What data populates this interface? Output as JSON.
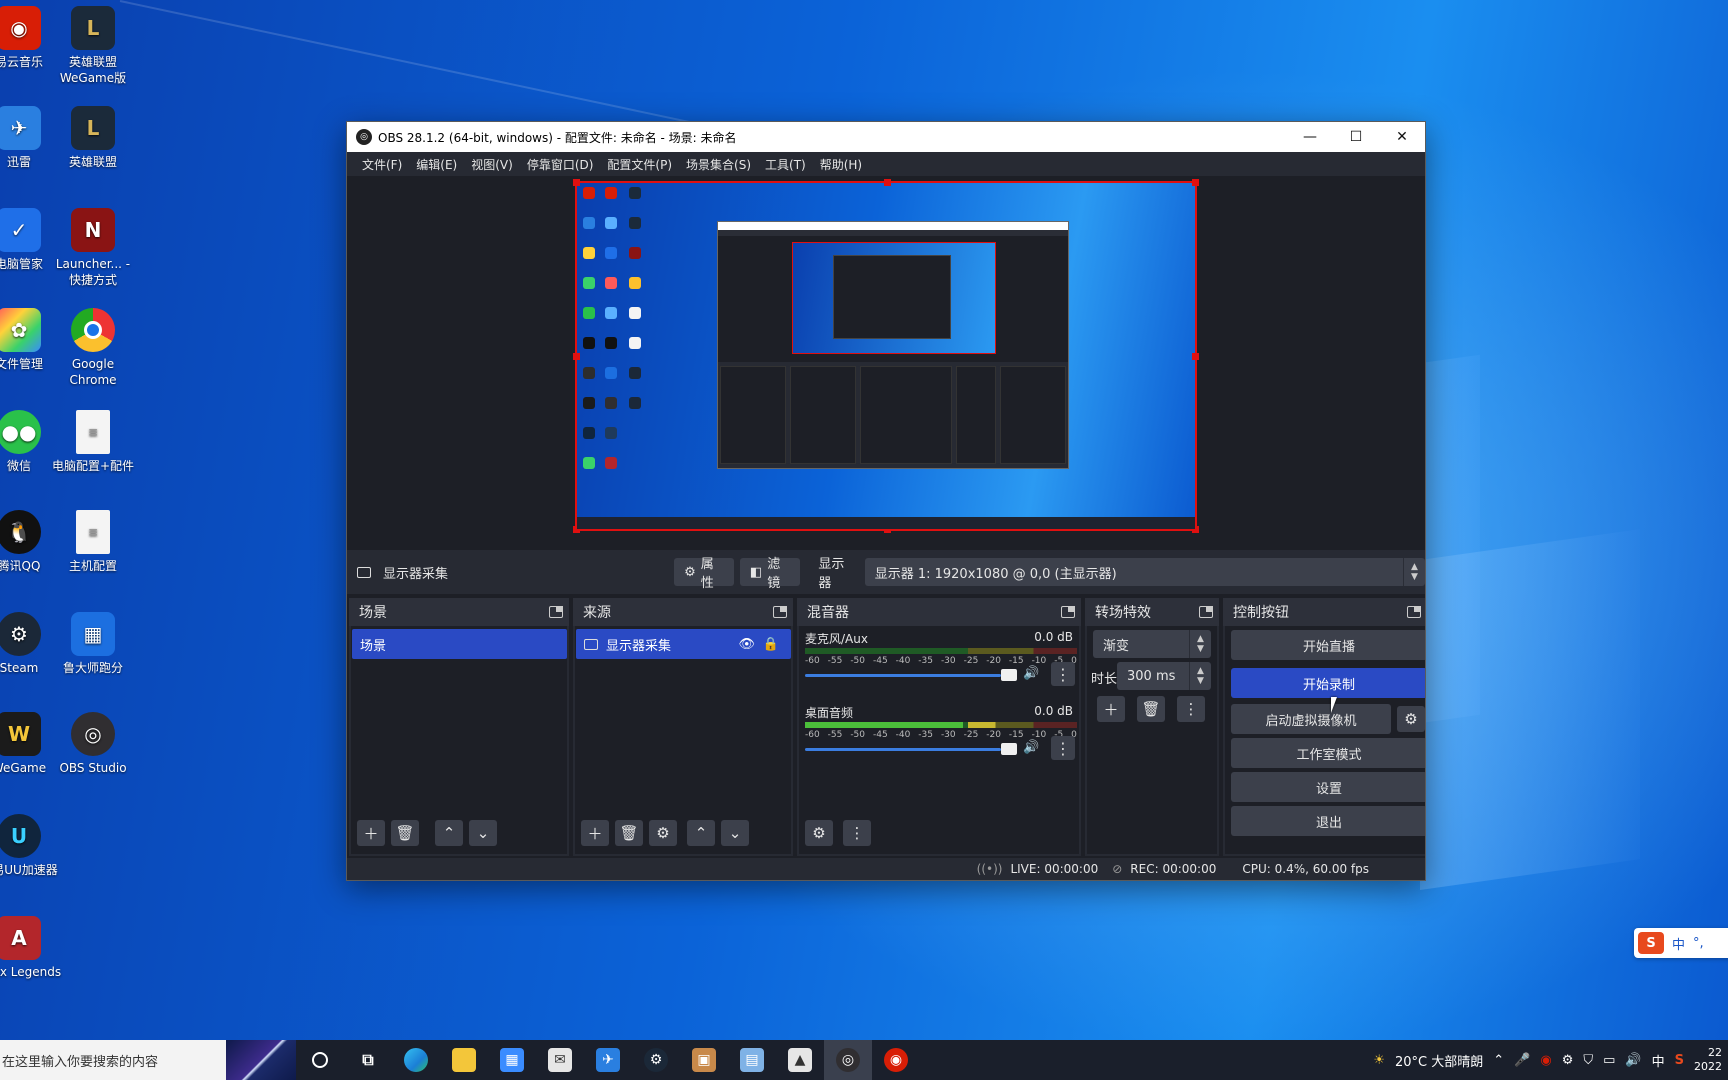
{
  "desktop": {
    "icons": [
      {
        "label": "易云音乐"
      },
      {
        "label": "英雄联盟 WeGame版"
      },
      {
        "label": "迅雷"
      },
      {
        "label": "英雄联盟"
      },
      {
        "label": "电脑管家"
      },
      {
        "label": "Launcher... - 快捷方式"
      },
      {
        "label": "文件管理"
      },
      {
        "label": "Google Chrome"
      },
      {
        "label": "微信"
      },
      {
        "label": "电脑配置+配件"
      },
      {
        "label": "腾讯QQ"
      },
      {
        "label": "主机配置"
      },
      {
        "label": "Steam"
      },
      {
        "label": "鲁大师跑分"
      },
      {
        "label": "WeGame"
      },
      {
        "label": "OBS Studio"
      },
      {
        "label": "网易UU加速器"
      },
      {
        "label": "Apex Legends"
      }
    ]
  },
  "window": {
    "title": "OBS 28.1.2 (64-bit, windows) - 配置文件: 未命名 - 场景: 未命名",
    "minimize": "—",
    "maximize": "☐",
    "close": "✕"
  },
  "menu": [
    "文件(F)",
    "编辑(E)",
    "视图(V)",
    "停靠窗口(D)",
    "配置文件(P)",
    "场景集合(S)",
    "工具(T)",
    "帮助(H)"
  ],
  "source_toolbar": {
    "source_name": "显示器采集",
    "properties": "属性",
    "filters": "滤镜",
    "display_label": "显示器",
    "display_value": "显示器 1: 1920x1080 @ 0,0 (主显示器)"
  },
  "scenes": {
    "title": "场景",
    "items": [
      "场景"
    ]
  },
  "sources": {
    "title": "来源",
    "items": [
      "显示器采集"
    ]
  },
  "mixer": {
    "title": "混音器",
    "channels": [
      {
        "name": "麦克风/Aux",
        "db": "0.0 dB"
      },
      {
        "name": "桌面音频",
        "db": "0.0 dB"
      }
    ],
    "scale": [
      "-60",
      "-55",
      "-50",
      "-45",
      "-40",
      "-35",
      "-30",
      "-25",
      "-20",
      "-15",
      "-10",
      "-5",
      "0"
    ]
  },
  "transitions": {
    "title": "转场特效",
    "selected": "渐变",
    "duration_label": "时长",
    "duration_value": "300 ms"
  },
  "controls": {
    "title": "控制按钮",
    "start_streaming": "开始直播",
    "start_recording": "开始录制",
    "virtual_camera": "启动虚拟摄像机",
    "studio_mode": "工作室模式",
    "settings": "设置",
    "exit": "退出"
  },
  "status": {
    "live": "LIVE: 00:00:00",
    "rec": "REC: 00:00:00",
    "cpu": "CPU: 0.4%, 60.00 fps"
  },
  "taskbar": {
    "search_placeholder": "在这里输入你要搜索的内容",
    "weather": "20°C 大部晴朗",
    "ime": "中",
    "clock": "22",
    "date": "2022"
  },
  "ime_bar": {
    "logo": "S",
    "mode": "中",
    "punct": "°,"
  }
}
